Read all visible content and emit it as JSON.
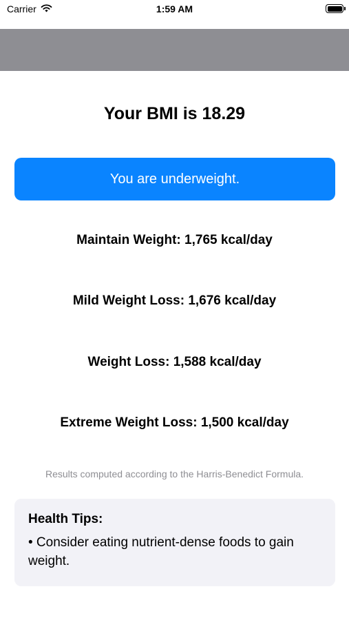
{
  "status_bar": {
    "carrier": "Carrier",
    "time": "1:59 AM"
  },
  "result": {
    "bmi_title": "Your BMI is 18.29",
    "category": "You are underweight."
  },
  "calories": [
    "Maintain Weight: 1,765 kcal/day",
    "Mild Weight Loss: 1,676 kcal/day",
    "Weight Loss: 1,588 kcal/day",
    "Extreme Weight Loss: 1,500 kcal/day"
  ],
  "formula_note": "Results computed according to the Harris-Benedict Formula.",
  "health_tips": {
    "title": "Health Tips:",
    "tip": "• Consider eating nutrient-dense foods to gain weight."
  },
  "colors": {
    "accent": "#0a84ff",
    "nav_bar": "#8e8e93",
    "card_background": "#f2f2f7",
    "secondary_text": "#8e8e93"
  }
}
